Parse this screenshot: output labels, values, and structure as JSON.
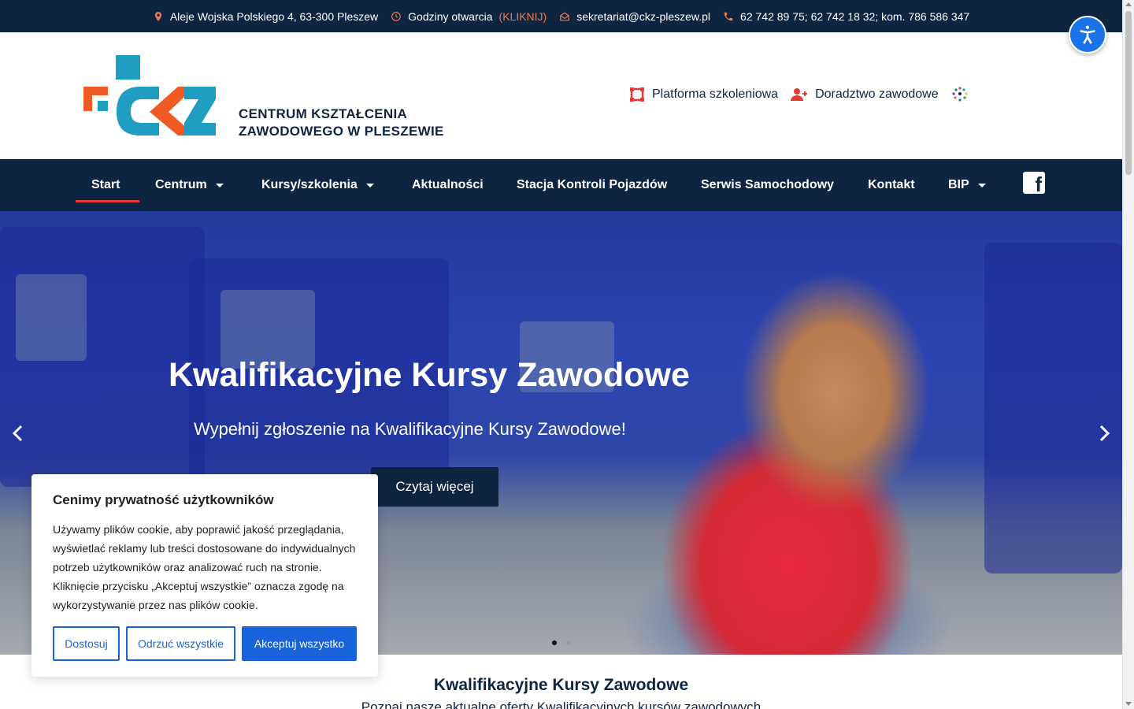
{
  "topbar": {
    "address": "Aleje Wojska Polskiego 4, 63-300 Pleszew",
    "hours_label": "Godziny otwarcia",
    "hours_link": "(KLIKNIJ)",
    "email": "sekretariat@ckz-pleszew.pl",
    "phone": "62 742 89 75; 62 742 18 32; kom. 786 586 347"
  },
  "header": {
    "logo_line1": "CENTRUM KSZTAŁCENIA",
    "logo_line2": "ZAWODOWEGO W PLESZEWIE",
    "links": {
      "platform": "Platforma szkoleniowa",
      "counseling": "Doradztwo zawodowe"
    }
  },
  "nav": {
    "items": [
      {
        "label": "Start",
        "active": true,
        "dropdown": false
      },
      {
        "label": "Centrum",
        "dropdown": true
      },
      {
        "label": "Kursy/szkolenia",
        "dropdown": true
      },
      {
        "label": "Aktualności",
        "dropdown": false
      },
      {
        "label": "Stacja Kontroli Pojazdów",
        "dropdown": false
      },
      {
        "label": "Serwis Samochodowy",
        "dropdown": false
      },
      {
        "label": "Kontakt",
        "dropdown": false
      },
      {
        "label": "BIP",
        "dropdown": true
      }
    ],
    "facebook_icon": "facebook-icon"
  },
  "hero": {
    "title": "Kwalifikacyjne Kursy Zawodowe",
    "subtitle": "Wypełnij zgłoszenie na Kwalifikacyjne Kursy Zawodowe!",
    "button": "Czytaj więcej",
    "active_slide": 1,
    "slide_count": 2
  },
  "section": {
    "title": "Kwalifikacyjne Kursy Zawodowe",
    "subtitle": "Poznaj nasze aktualne oferty Kwalifikacyjnych kursów zawodowych"
  },
  "cookie": {
    "title": "Cenimy prywatność użytkowników",
    "text": "Używamy plików cookie, aby poprawić jakość przeglądania, wyświetlać reklamy lub treści dostosowane do indywidualnych potrzeb użytkowników oraz analizować ruch na stronie. Kliknięcie przycisku „Akceptuj wszystkie” oznacza zgodę na wykorzystywanie przez nas plików cookie.",
    "customize": "Dostosuj",
    "reject": "Odrzuć wszystkie",
    "accept": "Akceptuj wszystko"
  },
  "colors": {
    "navy": "#0e2542",
    "accent_orange": "#f07a4a",
    "active_red": "#e53935",
    "cookie_blue": "#1863dc",
    "logo_teal": "#1f9ec2",
    "logo_orange": "#ef5a24"
  }
}
